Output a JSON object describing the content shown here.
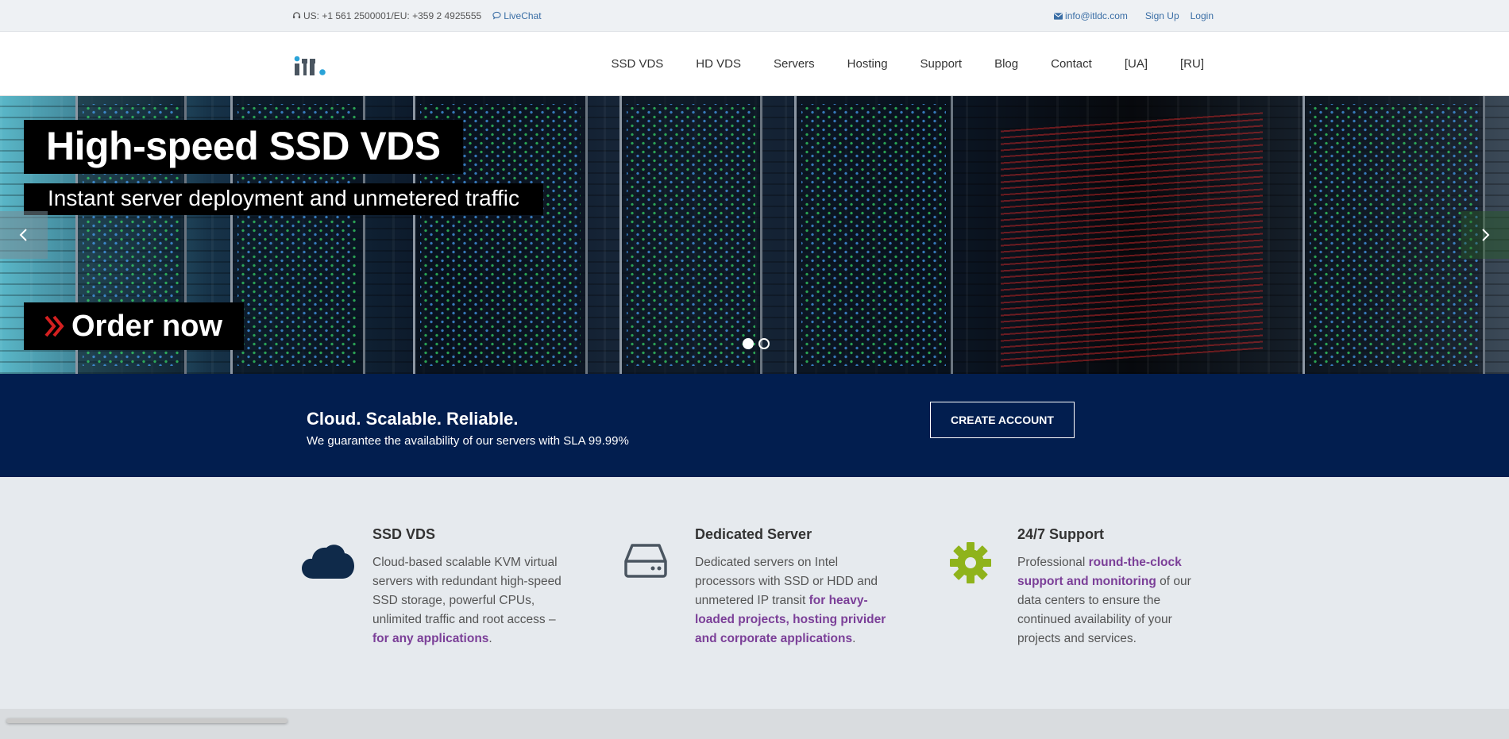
{
  "topbar": {
    "phones": "US: +1 561 2500001/EU: +359 2 4925555",
    "livechat": "LiveChat",
    "email": "info@itldc.com",
    "signup": "Sign Up",
    "login": "Login"
  },
  "nav": {
    "items": [
      {
        "label": "SSD VDS"
      },
      {
        "label": "HD VDS"
      },
      {
        "label": "Servers"
      },
      {
        "label": "Hosting"
      },
      {
        "label": "Support"
      },
      {
        "label": "Blog"
      },
      {
        "label": "Contact"
      },
      {
        "label": "[UA]"
      },
      {
        "label": "[RU]"
      }
    ]
  },
  "hero": {
    "title": "High-speed SSD VDS",
    "subtitle": "Instant server deployment and unmetered traffic",
    "cta": "Order now"
  },
  "band": {
    "heading": "Cloud. Scalable. Reliable.",
    "text": "We guarantee the availability of our servers with SLA 99.99%",
    "button": "CREATE ACCOUNT"
  },
  "features": [
    {
      "title": "SSD VDS",
      "icon": "cloud-icon",
      "text": "Cloud-based scalable KVM virtual servers with redundant high-speed SSD storage, powerful CPUs, unlimited traffic and root access –",
      "highlight": "for any applications",
      "tail": "."
    },
    {
      "title": "Dedicated Server",
      "icon": "hard-drive-icon",
      "text": "Dedicated servers on Intel processors with SSD or HDD and unmetered IP transit",
      "highlight": "for heavy-loaded projects, hosting privider and corporate applications",
      "tail": "."
    },
    {
      "title": "24/7 Support",
      "icon": "gear-icon",
      "lead": "Professional",
      "highlight": "round-the-clock support and monitoring",
      "tail": "of our data centers to ensure the continued availability of your projects and services."
    }
  ],
  "colors": {
    "band_bg": "#021e4f",
    "accent_purple": "#7b3f98",
    "gear_green": "#8fb31b",
    "icon_navy": "#0f2a4a",
    "link_blue": "#3a6ea5"
  }
}
